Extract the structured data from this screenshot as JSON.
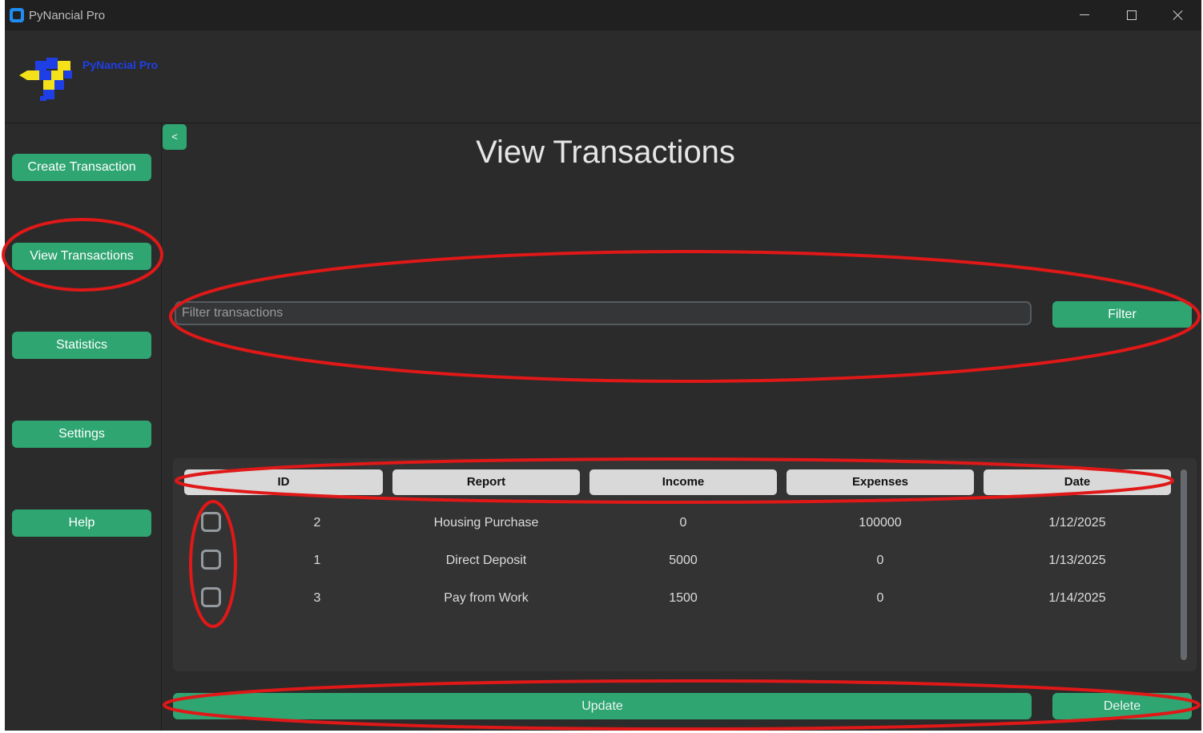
{
  "window": {
    "title": "PyNancial Pro"
  },
  "header": {
    "logo_text": "PyNancial Pro"
  },
  "sidebar": {
    "items": [
      {
        "label": "Create Transaction"
      },
      {
        "label": "View Transactions"
      },
      {
        "label": "Statistics"
      },
      {
        "label": "Settings"
      },
      {
        "label": "Help"
      }
    ],
    "collapse_label": "<"
  },
  "main": {
    "title": "View Transactions",
    "filter": {
      "placeholder": "Filter transactions",
      "value": "",
      "button_label": "Filter"
    },
    "table": {
      "headers": [
        "ID",
        "Report",
        "Income",
        "Expenses",
        "Date"
      ],
      "rows": [
        {
          "checked": false,
          "id": "2",
          "report": "Housing Purchase",
          "income": "0",
          "expenses": "100000",
          "date": "1/12/2025"
        },
        {
          "checked": false,
          "id": "1",
          "report": "Direct Deposit",
          "income": "5000",
          "expenses": "0",
          "date": "1/13/2025"
        },
        {
          "checked": false,
          "id": "3",
          "report": "Pay from Work",
          "income": "1500",
          "expenses": "0",
          "date": "1/14/2025"
        }
      ]
    },
    "actions": {
      "update_label": "Update",
      "delete_label": "Delete"
    }
  },
  "colors": {
    "accent": "#2fa572",
    "background": "#2b2b2b",
    "header_cell": "#d9d9d9",
    "annotation": "#e01818",
    "logo_blue": "#1f3fe6",
    "logo_yellow": "#f5e11a"
  }
}
